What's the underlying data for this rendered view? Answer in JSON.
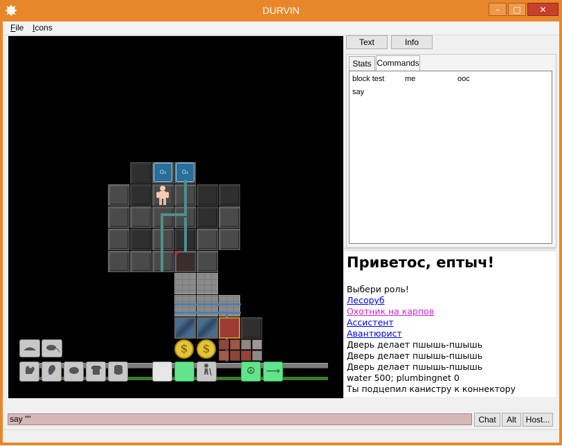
{
  "window": {
    "title": "DURVIN",
    "minimize": "–",
    "maximize": "□",
    "close": "✕",
    "accent_color": "#e8872a"
  },
  "menu": {
    "file_first": "F",
    "file_rest": "ile",
    "icons_first": "I",
    "icons_rest": "cons"
  },
  "panel_buttons": {
    "text": "Text",
    "info": "Info"
  },
  "tabs": {
    "stats": "Stats",
    "commands": "Commands"
  },
  "commands": {
    "row1": [
      "block test",
      "me",
      "ooc"
    ],
    "row2": [
      "say"
    ]
  },
  "output": {
    "greeting": "Приветос, ептыч!",
    "lines": [
      {
        "text": "Выбери роль!",
        "type": "text"
      },
      {
        "text": "Лесоруб",
        "type": "link"
      },
      {
        "text": "Охотник на карпов",
        "type": "link-magenta"
      },
      {
        "text": "Ассистент",
        "type": "link"
      },
      {
        "text": "Авантюрист",
        "type": "link"
      },
      {
        "text": "Дверь делает пшышь-пшышь",
        "type": "text"
      },
      {
        "text": "Дверь делает пшышь-пшышь",
        "type": "text"
      },
      {
        "text": "Дверь делает пшышь-пшышь",
        "type": "text"
      },
      {
        "text": "water 500; plumbingnet 0",
        "type": "text"
      },
      {
        "text": "Ты подцепил канистру к коннектору",
        "type": "text"
      }
    ]
  },
  "input": {
    "value": "say \"\""
  },
  "bottom_buttons": {
    "chat": "Chat",
    "alt": "Alt",
    "host": "Host..."
  },
  "map": {
    "canister_label": "O₂"
  },
  "hud": {
    "peace_icon": "☮",
    "arrow_icon": "⟶",
    "coin_symbol": "$"
  }
}
